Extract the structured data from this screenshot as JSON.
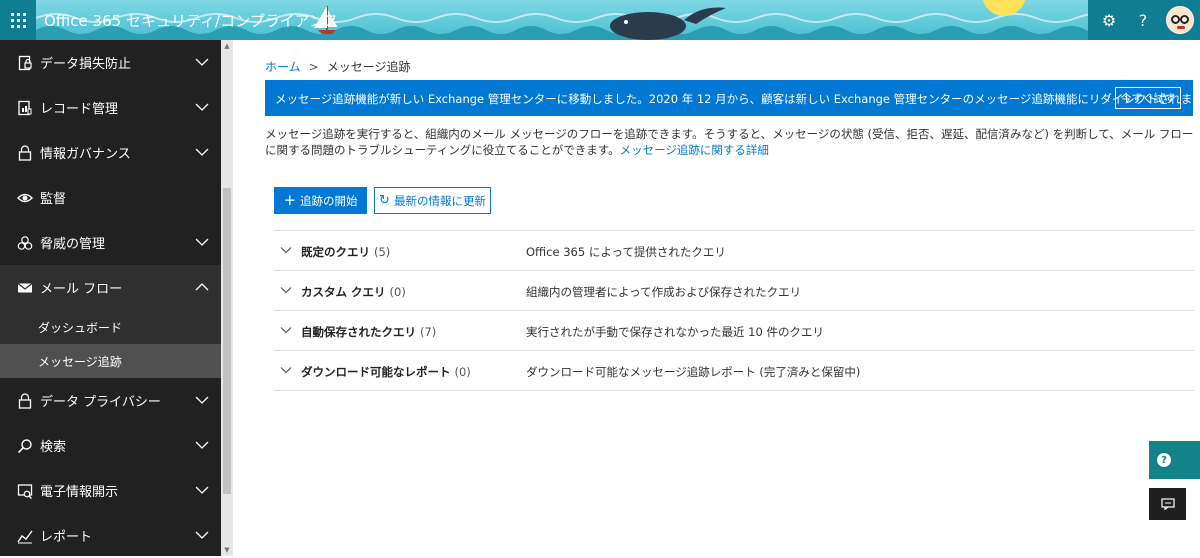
{
  "app": {
    "title": "Office 365 セキュリティ/コンプライアンス"
  },
  "topbar": {
    "icons": [
      "waffle-icon",
      "gear-icon",
      "help-icon",
      "avatar"
    ],
    "settings_glyph": "⚙",
    "help_glyph": "?"
  },
  "sidebar": {
    "items": [
      {
        "label": "データ損失防止",
        "icon": "lock-doc-icon",
        "expandable": true
      },
      {
        "label": "レコード管理",
        "icon": "records-icon",
        "expandable": true
      },
      {
        "label": "情報ガバナンス",
        "icon": "lock-icon",
        "expandable": true
      },
      {
        "label": "監督",
        "icon": "eye-icon",
        "expandable": false
      },
      {
        "label": "脅威の管理",
        "icon": "biohazard-icon",
        "expandable": true
      },
      {
        "label": "メール フロー",
        "icon": "mail-icon",
        "expandable": true,
        "open": true
      },
      {
        "label": "データ プライバシー",
        "icon": "lock-icon",
        "expandable": true
      },
      {
        "label": "検索",
        "icon": "search-icon",
        "expandable": true
      },
      {
        "label": "電子情報開示",
        "icon": "discovery-icon",
        "expandable": true
      },
      {
        "label": "レポート",
        "icon": "chart-icon",
        "expandable": true
      }
    ],
    "subitems": [
      {
        "label": "ダッシュボード",
        "active": false
      },
      {
        "label": "メッセージ追跡",
        "active": true
      }
    ]
  },
  "breadcrumb": {
    "home": "ホーム",
    "separator": ">",
    "current": "メッセージ追跡"
  },
  "info_bar": {
    "message": "メッセージ追跡機能が新しい Exchange 管理センターに移動しました。2020 年 12 月から、顧客は新しい Exchange 管理センターのメッセージ追跡機能にリダイレクトされます。",
    "button": "今すぐ試す",
    "color": "#0078d4"
  },
  "description": {
    "text": "メッセージ追跡を実行すると、組織内のメール メッセージのフローを追跡できます。そうすると、メッセージの状態 (受信、拒否、遅延、配信済みなど) を判断して、メール フローに関する問題のトラブルシューティングに役立てることができます。",
    "link": "メッセージ追跡に関する詳細"
  },
  "actions": {
    "start": "追跡の開始",
    "refresh": "最新の情報に更新"
  },
  "queries": [
    {
      "name": "既定のクエリ",
      "count": "(5)",
      "desc": "Office 365 によって提供されたクエリ"
    },
    {
      "name": "カスタム クエリ",
      "count": "(0)",
      "desc": "組織内の管理者によって作成および保存されたクエリ"
    },
    {
      "name": "自動保存されたクエリ",
      "count": "(7)",
      "desc": "実行されたが手動で保存されなかった最近 10 件のクエリ"
    },
    {
      "name": "ダウンロード可能なレポート",
      "count": "(0)",
      "desc": "ダウンロード可能なメッセージ追跡レポート (完了済みと保留中)"
    }
  ],
  "floating": {
    "help_glyph": "?",
    "help_icon": "help-circle-icon",
    "chat_icon": "chat-icon"
  },
  "colors": {
    "accent": "#0078d4",
    "sidebar_bg": "#212121",
    "sidebar_active": "#505050",
    "teal": "#0f7d92"
  }
}
